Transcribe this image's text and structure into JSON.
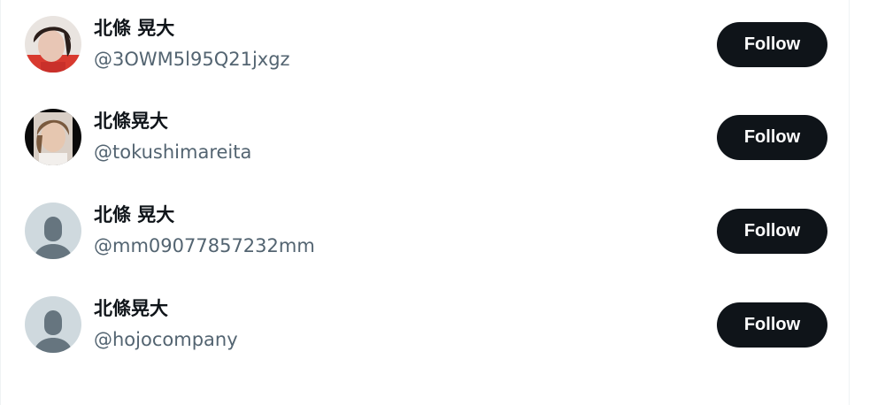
{
  "users": [
    {
      "display_name": "北條 晃大",
      "handle": "@3OWM5l95Q21jxgz",
      "follow_label": "Follow",
      "avatar": "photo-avatar-red-shirt"
    },
    {
      "display_name": "北條晃大",
      "handle": "@tokushimareita",
      "follow_label": "Follow",
      "avatar": "photo-avatar-selfie"
    },
    {
      "display_name": "北條 晃大",
      "handle": "@mm09077857232mm",
      "follow_label": "Follow",
      "avatar": "default-avatar"
    },
    {
      "display_name": "北條晃大",
      "handle": "@hojocompany",
      "follow_label": "Follow",
      "avatar": "default-avatar"
    }
  ],
  "colors": {
    "button_bg": "#0f1419",
    "button_text": "#ffffff",
    "name_text": "#0f1419",
    "handle_text": "#536471",
    "default_avatar_bg": "#cfd9de",
    "default_avatar_figure": "#66757f"
  }
}
